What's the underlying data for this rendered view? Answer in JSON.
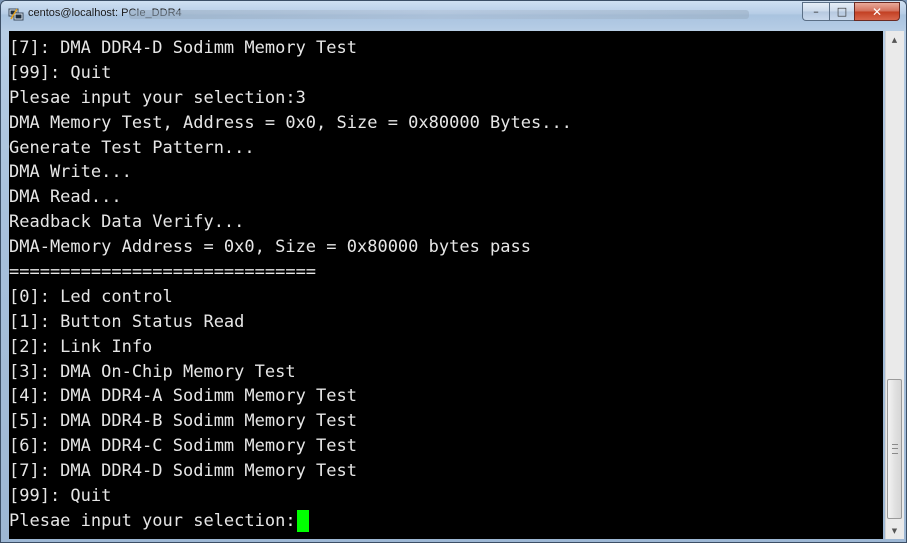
{
  "window": {
    "title": "centos@localhost: PCIe_DDR4",
    "title_icon": "putty-terminal-icon",
    "buttons": {
      "minimize": "–",
      "maximize": "□",
      "close": "✕"
    }
  },
  "terminal": {
    "lines": [
      "[7]: DMA DDR4-D Sodimm Memory Test",
      "[99]: Quit",
      "Plesae input your selection:3",
      "DMA Memory Test, Address = 0x0, Size = 0x80000 Bytes...",
      "Generate Test Pattern...",
      "DMA Write...",
      "DMA Read...",
      "Readback Data Verify...",
      "DMA-Memory Address = 0x0, Size = 0x80000 bytes pass",
      "==============================",
      "[0]: Led control",
      "[1]: Button Status Read",
      "[2]: Link Info",
      "[3]: DMA On-Chip Memory Test",
      "[4]: DMA DDR4-A Sodimm Memory Test",
      "[5]: DMA DDR4-B Sodimm Memory Test",
      "[6]: DMA DDR4-C Sodimm Memory Test",
      "[7]: DMA DDR4-D Sodimm Memory Test",
      "[99]: Quit"
    ],
    "prompt": "Plesae input your selection:",
    "cursor_color": "#00ff00",
    "text_color": "#e6e6e6",
    "background": "#000000"
  },
  "scrollbar": {
    "up_arrow": "▲",
    "down_arrow": "▼"
  }
}
